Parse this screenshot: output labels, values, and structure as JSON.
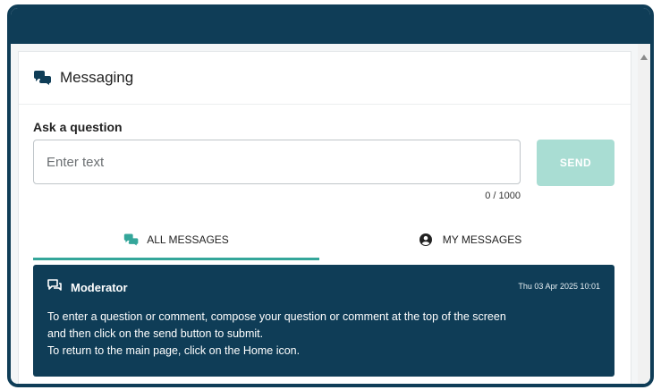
{
  "messaging": {
    "title": "Messaging",
    "ask_label": "Ask a question",
    "input_placeholder": "Enter text",
    "input_value": "",
    "send_label": "SEND",
    "char_count": "0 / 1000"
  },
  "tabs": [
    {
      "label": "ALL MESSAGES",
      "active": true,
      "icon": "chat-bubbles-icon"
    },
    {
      "label": "MY MESSAGES",
      "active": false,
      "icon": "user-circle-icon"
    }
  ],
  "messages": [
    {
      "author": "Moderator",
      "date": "Thu 03 Apr 2025 10:01",
      "lines": [
        "To enter a question or comment, compose your question or comment at the top of the screen",
        "and then click on the send button to submit.",
        "To return to the main page, click on the Home icon."
      ],
      "icon": "moderator-chat-icon"
    }
  ],
  "colors": {
    "header": "#0f3d57",
    "accent": "#34a69a",
    "send_disabled": "#a9ddd3"
  }
}
